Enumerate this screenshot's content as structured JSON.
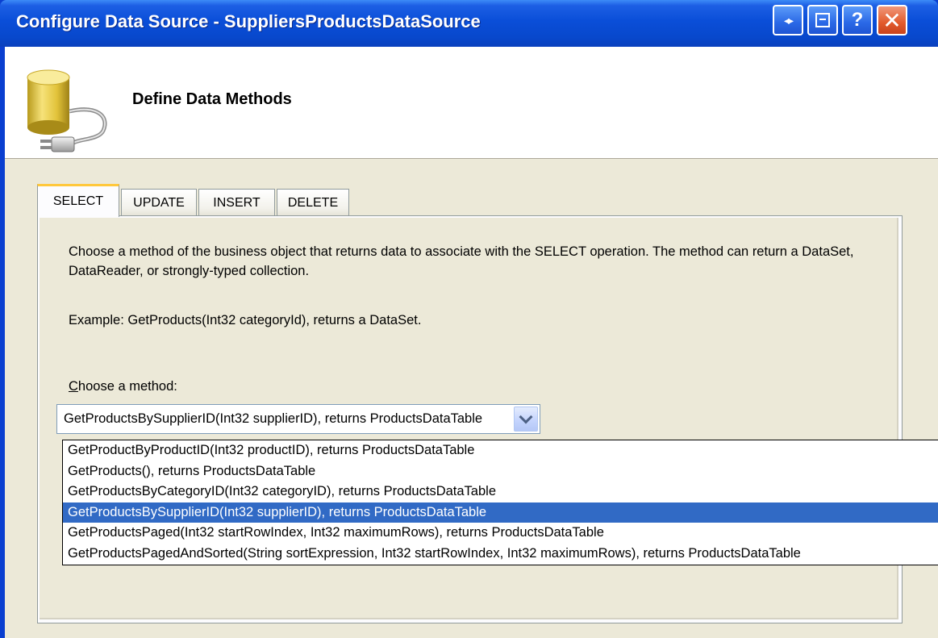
{
  "window": {
    "title": "Configure Data Source - SuppliersProductsDataSource",
    "buttons": {
      "help_label": "?",
      "close_label": "✕"
    }
  },
  "header": {
    "title": "Define Data Methods",
    "icon": "database-plug-icon"
  },
  "tabs": [
    {
      "label": "SELECT",
      "active": true
    },
    {
      "label": "UPDATE",
      "active": false
    },
    {
      "label": "INSERT",
      "active": false
    },
    {
      "label": "DELETE",
      "active": false
    }
  ],
  "panel": {
    "description": "Choose a method of the business object that returns data to associate with the SELECT operation. The method can return a DataSet, DataReader, or strongly-typed collection.",
    "example": "Example: GetProducts(Int32 categoryId), returns a DataSet.",
    "choose_label_mnemonic": "C",
    "choose_label_rest": "hoose a method:"
  },
  "method_select": {
    "value": "GetProductsBySupplierID(Int32 supplierID), returns ProductsDataTable",
    "options": [
      "GetProductByProductID(Int32 productID), returns ProductsDataTable",
      "GetProducts(), returns ProductsDataTable",
      "GetProductsByCategoryID(Int32 categoryID), returns ProductsDataTable",
      "GetProductsBySupplierID(Int32 supplierID), returns ProductsDataTable",
      "GetProductsPaged(Int32 startRowIndex, Int32 maximumRows), returns ProductsDataTable",
      "GetProductsPagedAndSorted(String sortExpression, Int32 startRowIndex, Int32 maximumRows), returns ProductsDataTable"
    ],
    "selected_index": 3
  },
  "colors": {
    "titlebar": "#0a4ed8",
    "dialog_bg": "#ece9d8",
    "selection": "#316ac5",
    "tab_accent": "#ffc83c"
  }
}
